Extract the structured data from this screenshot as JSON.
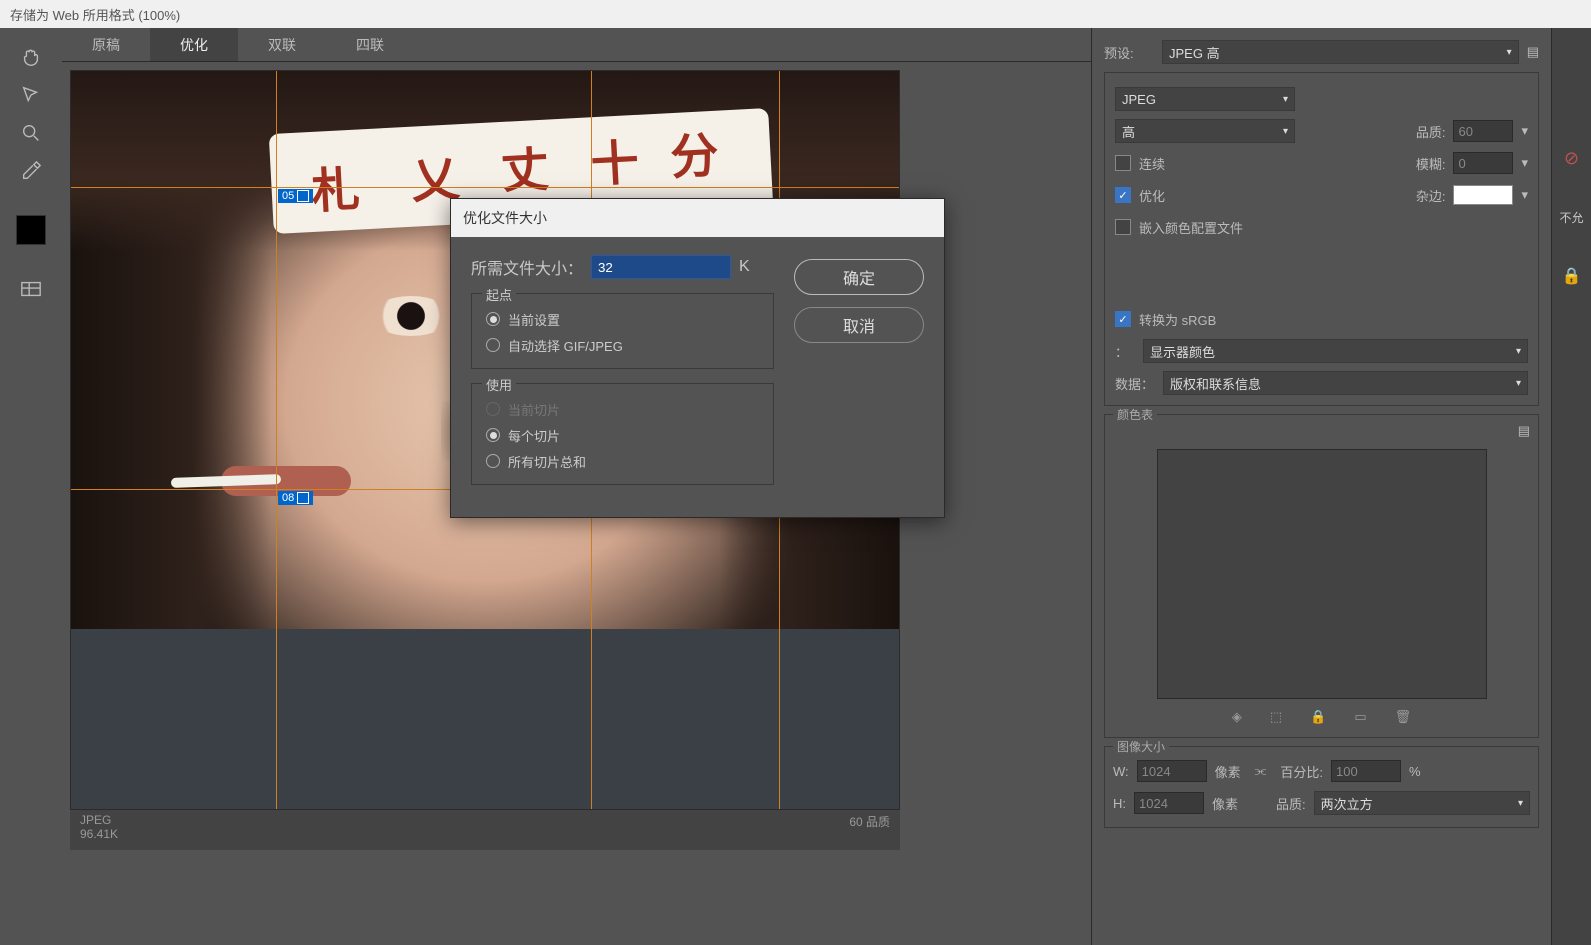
{
  "window": {
    "title": "存储为 Web 所用格式 (100%)"
  },
  "tools": {
    "hand": "hand-icon",
    "slice_select": "slice-select-icon",
    "zoom": "zoom-icon",
    "eyedropper": "eyedropper-icon",
    "swatch": "#000000",
    "toggle": "slice-visibility-icon"
  },
  "tabs": [
    {
      "id": "orig",
      "label": "原稿",
      "active": false
    },
    {
      "id": "opt",
      "label": "优化",
      "active": true
    },
    {
      "id": "two",
      "label": "双联",
      "active": false
    },
    {
      "id": "four",
      "label": "四联",
      "active": false
    }
  ],
  "slices": {
    "tag1": "05",
    "tag2": "08"
  },
  "status": {
    "format": "JPEG",
    "size": "96.41K",
    "quality": "60 品质"
  },
  "right": {
    "preset_label": "预设:",
    "preset_value": "JPEG 高",
    "format_value": "JPEG",
    "quality_sel": "高",
    "quality_lbl": "品质:",
    "quality_val": "60",
    "progressive": "连续",
    "blur_lbl": "模糊:",
    "blur_val": "0",
    "optimized": "优化",
    "matte_lbl": "杂边:",
    "embed_profile": "嵌入颜色配置文件",
    "convert_srgb": "转换为 sRGB",
    "preview_lbl": "：",
    "preview_val": "显示器颜色",
    "meta_lbl": "数据：",
    "meta_val": "版权和联系信息",
    "colortable_lbl": "颜色表",
    "imgsize_lbl": "图像大小",
    "w_lbl": "W:",
    "w_val": "1024",
    "px": "像素",
    "h_lbl": "H:",
    "h_val": "1024",
    "pct_lbl": "百分比:",
    "pct_val": "100",
    "pct_unit": "%",
    "q_lbl": "品质:",
    "q_val": "两次立方"
  },
  "far": {
    "stop": "不允"
  },
  "modal": {
    "title": "优化文件大小",
    "filesize_lbl": "所需文件大小：",
    "filesize_val": "32",
    "filesize_unit": "K",
    "ok": "确定",
    "cancel": "取消",
    "start_title": "起点",
    "start_opts": [
      {
        "id": "current",
        "label": "当前设置",
        "checked": true,
        "disabled": false
      },
      {
        "id": "auto",
        "label": "自动选择 GIF/JPEG",
        "checked": false,
        "disabled": false
      }
    ],
    "use_title": "使用",
    "use_opts": [
      {
        "id": "cur_slice",
        "label": "当前切片",
        "checked": false,
        "disabled": true
      },
      {
        "id": "each",
        "label": "每个切片",
        "checked": true,
        "disabled": false
      },
      {
        "id": "total",
        "label": "所有切片总和",
        "checked": false,
        "disabled": false
      }
    ]
  }
}
